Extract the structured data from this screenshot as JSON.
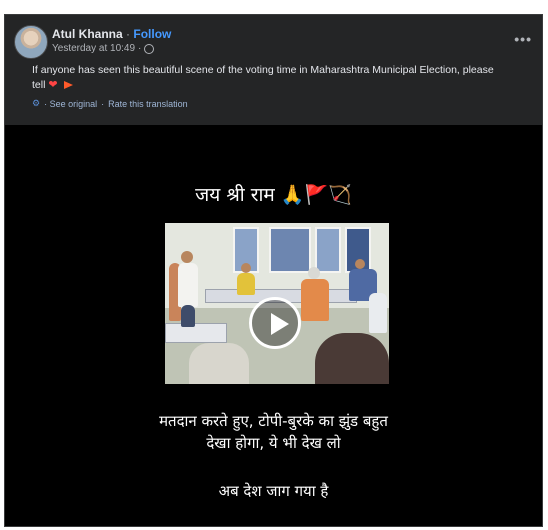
{
  "post": {
    "author": "Atul Khanna",
    "separator": "·",
    "follow_label": "Follow",
    "timestamp": "Yesterday at 10:49",
    "timestamp_separator": "·",
    "more_label": "•••",
    "caption": "If anyone has seen this beautiful scene of the voting time in Maharashtra Municipal Election, please tell",
    "heart": "❤",
    "see_original": "· See original",
    "translate_sep": "·",
    "rate_translation": "Rate this translation"
  },
  "video": {
    "title": "जय श्री राम 🙏🚩🏹",
    "line1": "मतदान करते हुए, टोपी-बुरके का झुंड बहुत",
    "line2": "देखा होगा, ये भी देख लो",
    "line3": "अब देश जाग गया है"
  },
  "colors": {
    "background": "#242526",
    "accent": "#4599ff",
    "video_bg": "#000000"
  }
}
